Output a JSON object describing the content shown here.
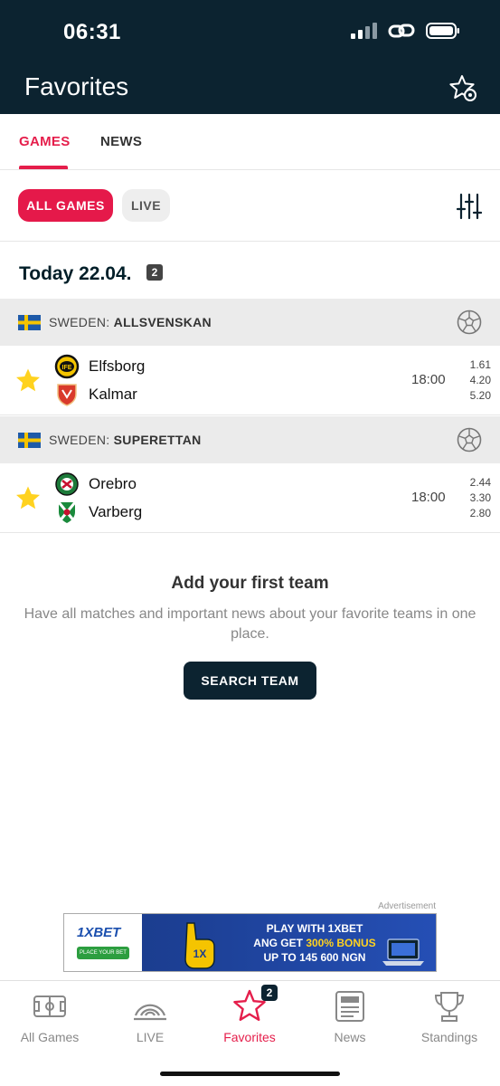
{
  "status_bar": {
    "time": "06:31"
  },
  "header": {
    "title": "Favorites"
  },
  "tabs": [
    {
      "label": "GAMES",
      "active": true
    },
    {
      "label": "NEWS",
      "active": false
    }
  ],
  "filters": {
    "all_games": "ALL GAMES",
    "live": "LIVE"
  },
  "date": {
    "label": "Today 22.04.",
    "count": "2"
  },
  "leagues": [
    {
      "country": "SWEDEN:",
      "name": "ALLSVENSKAN",
      "match": {
        "home": "Elfsborg",
        "away": "Kalmar",
        "time": "18:00",
        "odds": [
          "1.61",
          "4.20",
          "5.20"
        ]
      }
    },
    {
      "country": "SWEDEN:",
      "name": "SUPERETTAN",
      "match": {
        "home": "Orebro",
        "away": "Varberg",
        "time": "18:00",
        "odds": [
          "2.44",
          "3.30",
          "2.80"
        ]
      }
    }
  ],
  "empty_state": {
    "title": "Add your first team",
    "description": "Have all matches and important news about your favorite teams in one place.",
    "button": "SEARCH TEAM"
  },
  "ad": {
    "label": "Advertisement",
    "brand": "1XBET",
    "brand_sub": "PLACE YOUR BET",
    "line1": "PLAY WITH 1XBET",
    "line2_pre": "ANG GET ",
    "line2_hl": "300% BONUS",
    "line3": "UP TO 145 600 NGN"
  },
  "bottom_nav": [
    {
      "label": "All Games",
      "icon": "pitch-icon"
    },
    {
      "label": "LIVE",
      "icon": "live-signal-icon"
    },
    {
      "label": "Favorites",
      "icon": "star-icon",
      "badge": "2",
      "active": true
    },
    {
      "label": "News",
      "icon": "newspaper-icon"
    },
    {
      "label": "Standings",
      "icon": "trophy-icon"
    }
  ],
  "colors": {
    "accent": "#e51e4b",
    "dark": "#0c2330",
    "league_bg": "#ebebeb",
    "star": "#ffd21f"
  }
}
